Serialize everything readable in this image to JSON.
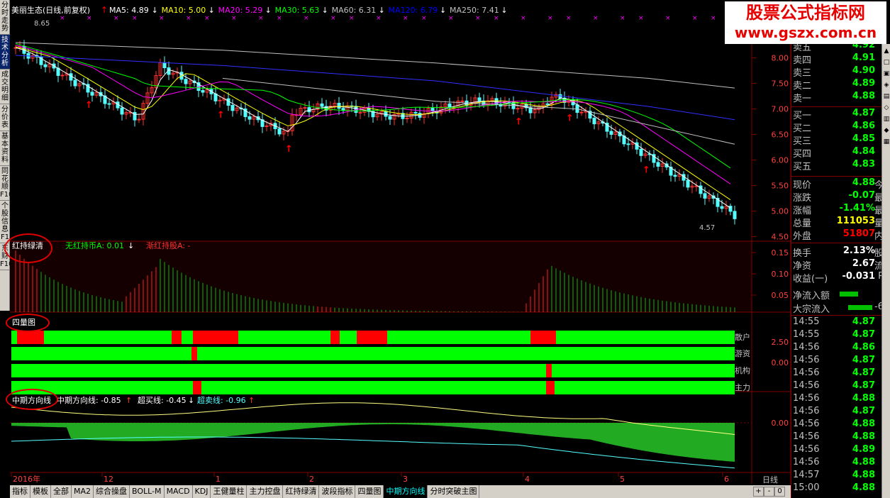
{
  "nav": [
    "分时走势",
    "技术分析",
    "成交明细",
    "分价表",
    "基本资料",
    "同花顺F10",
    "个股信息F1",
    "东财F10"
  ],
  "header": {
    "stock": "美丽生态(日线,前复权)",
    "ma": [
      {
        "label": "MA5: 4.89",
        "arrow": "↓",
        "color": "#ffffff"
      },
      {
        "label": "MA10: 5.00",
        "arrow": "↓",
        "color": "#ffff00"
      },
      {
        "label": "MA20: 5.29",
        "arrow": "↓",
        "color": "#ff00ff"
      },
      {
        "label": "MA30: 5.63",
        "arrow": "↓",
        "color": "#00ff00"
      },
      {
        "label": "MA60: 6.31",
        "arrow": "↓",
        "color": "#c0c0c0"
      },
      {
        "label": "MA120: 6.79",
        "arrow": "↓",
        "color": "#0000ff"
      },
      {
        "label": "MA250: 7.41",
        "arrow": "↓",
        "color": "#c0c0c0"
      }
    ],
    "high_label": "8.65",
    "low_label": "4.57"
  },
  "price_axis": [
    "8.00",
    "7.50",
    "7.00",
    "6.50",
    "6.00",
    "5.50",
    "5.00",
    "4.50"
  ],
  "panel2": {
    "title": "红持绿清",
    "l1": "无红持币A: 0.01",
    "l1a": "↓",
    "l2": "渐红持股A: -",
    "axis": [
      "0.15",
      "0.10",
      "0.05"
    ]
  },
  "panel3": {
    "title": "四量图",
    "rows": [
      "散户",
      "游资",
      "机构",
      "主力"
    ],
    "axis": [
      "2.50",
      "0.00"
    ]
  },
  "panel4": {
    "title": "中期方向线",
    "l1": "中期方向线: -0.85",
    "l1a": "↑",
    "l2": "超买线: -0.45",
    "l2a": "↓",
    "l3": "超卖线: -0.96",
    "l3a": "↑",
    "axis": [
      "0.00"
    ]
  },
  "xaxis": [
    "2016年",
    "12",
    "1",
    "2",
    "3",
    "4",
    "5",
    "6"
  ],
  "brand": {
    "line1": "股票公式指标网",
    "line2": "www.gszx.com.cn"
  },
  "orderbook": [
    {
      "label": "卖五",
      "value": "4.92",
      "color": "#00ff00"
    },
    {
      "label": "卖四",
      "value": "4.91",
      "color": "#00ff00"
    },
    {
      "label": "卖三",
      "value": "4.90",
      "color": "#00ff00"
    },
    {
      "label": "卖二",
      "value": "4.89",
      "color": "#00ff00"
    },
    {
      "label": "卖一",
      "value": "4.88",
      "color": "#00ff00"
    },
    {
      "label": "买一",
      "value": "4.87",
      "color": "#00ff00"
    },
    {
      "label": "买二",
      "value": "4.86",
      "color": "#00ff00"
    },
    {
      "label": "买三",
      "value": "4.85",
      "color": "#00ff00"
    },
    {
      "label": "买四",
      "value": "4.84",
      "color": "#00ff00"
    },
    {
      "label": "买五",
      "value": "4.83",
      "color": "#00ff00"
    }
  ],
  "stats": [
    {
      "label": "现价",
      "value": "4.88",
      "color": "#00ff00",
      "tail": "今"
    },
    {
      "label": "涨跌",
      "value": "-0.07",
      "color": "#00ff00",
      "tail": "最"
    },
    {
      "label": "涨幅",
      "value": "-1.41%",
      "color": "#00ff00",
      "tail": "最"
    },
    {
      "label": "总量",
      "value": "111053",
      "color": "#ffff00",
      "tail": "量"
    },
    {
      "label": "外盘",
      "value": "51807",
      "color": "#ff0000",
      "tail": "内"
    },
    {
      "label": "换手",
      "value": "2.13%",
      "color": "#ffffff",
      "tail": "股"
    },
    {
      "label": "净资",
      "value": "2.67",
      "color": "#ffffff",
      "tail": "流"
    },
    {
      "label": "收益(一)",
      "value": "-0.031",
      "color": "#ffffff",
      "tail": "P"
    }
  ],
  "flows": [
    {
      "label": "净流入额",
      "tail": ""
    },
    {
      "label": "大宗流入",
      "tail": "-6"
    }
  ],
  "ticks": [
    {
      "time": "14:55",
      "price": "4.87"
    },
    {
      "time": "14:55",
      "price": "4.87"
    },
    {
      "time": "14:56",
      "price": "4.86"
    },
    {
      "time": "14:56",
      "price": "4.87"
    },
    {
      "time": "14:56",
      "price": "4.87"
    },
    {
      "time": "14:56",
      "price": "4.87"
    },
    {
      "time": "14:56",
      "price": "4.88"
    },
    {
      "time": "14:56",
      "price": "4.87"
    },
    {
      "time": "14:56",
      "price": "4.88"
    },
    {
      "time": "14:56",
      "price": "4.88"
    },
    {
      "time": "14:56",
      "price": "4.89"
    },
    {
      "time": "14:56",
      "price": "4.88"
    },
    {
      "time": "14:57",
      "price": "4.88"
    },
    {
      "time": "15:00",
      "price": "4.88"
    }
  ],
  "tabs": [
    "指标",
    "模板",
    "全部",
    "MA2",
    "综合操盘",
    "BOLL-M",
    "MACD",
    "KDJ",
    "王健量柱",
    "主力控盘",
    "红持绿清",
    "波段指标",
    "四量图",
    "中期方向线",
    "分时突破主图"
  ],
  "active_tab": "中期方向线",
  "day_label": "日线",
  "zoom": [
    "+",
    "-",
    "0"
  ]
}
